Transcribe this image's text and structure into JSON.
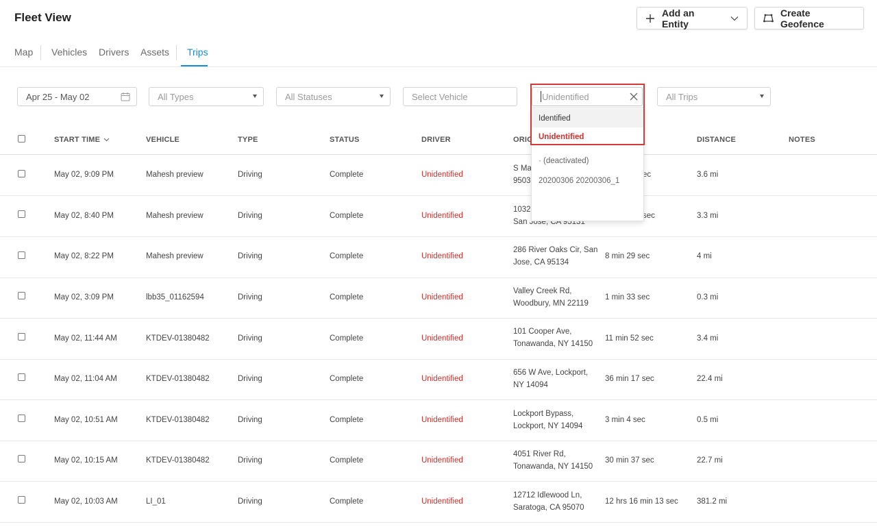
{
  "title": "Fleet View",
  "header_buttons": {
    "add_entity": "Add an Entity",
    "create_geofence": "Create Geofence"
  },
  "tabs": [
    "Map",
    "Vehicles",
    "Drivers",
    "Assets",
    "Trips"
  ],
  "active_tab": "Trips",
  "filters": {
    "date": "Apr 25 - May 02",
    "types_placeholder": "All Types",
    "statuses_placeholder": "All Statuses",
    "vehicle_placeholder": "Select Vehicle",
    "driver_placeholder": "Unidentified",
    "trips_placeholder": "All Trips"
  },
  "driver_dropdown": {
    "options": [
      "Identified",
      "Unidentified",
      "· (deactivated)",
      "20200306 20200306_1"
    ],
    "selected": "Unidentified",
    "hovered": "Identified"
  },
  "columns": [
    "START TIME",
    "VEHICLE",
    "TYPE",
    "STATUS",
    "DRIVER",
    "ORIG",
    "",
    "DISTANCE",
    "NOTES"
  ],
  "rows": [
    {
      "start": "May 02, 9:09 PM",
      "vehicle": "Mahesh preview",
      "type": "Driving",
      "status": "Complete",
      "driver": "Unidentified",
      "origin1": "S Ma",
      "origin2": "9503",
      "duration": "ec",
      "distance": "3.6 mi"
    },
    {
      "start": "May 02, 8:40 PM",
      "vehicle": "Mahesh preview",
      "type": "Driving",
      "status": "Complete",
      "driver": "Unidentified",
      "origin1": "1032",
      "origin2": "San Jose, CA 95131",
      "duration": "sec",
      "distance": "3.3 mi"
    },
    {
      "start": "May 02, 8:22 PM",
      "vehicle": "Mahesh preview",
      "type": "Driving",
      "status": "Complete",
      "driver": "Unidentified",
      "origin1": "286 River Oaks Cir, San",
      "origin2": "Jose, CA 95134",
      "duration": "8 min 29 sec",
      "distance": "4 mi"
    },
    {
      "start": "May 02, 3:09 PM",
      "vehicle": "lbb35_01162594",
      "type": "Driving",
      "status": "Complete",
      "driver": "Unidentified",
      "origin1": "Valley Creek Rd,",
      "origin2": "Woodbury, MN 22119",
      "duration": "1 min 33 sec",
      "distance": "0.3 mi"
    },
    {
      "start": "May 02, 11:44 AM",
      "vehicle": "KTDEV-01380482",
      "type": "Driving",
      "status": "Complete",
      "driver": "Unidentified",
      "origin1": "101 Cooper Ave,",
      "origin2": "Tonawanda, NY 14150",
      "duration": "11 min 52 sec",
      "distance": "3.4 mi"
    },
    {
      "start": "May 02, 11:04 AM",
      "vehicle": "KTDEV-01380482",
      "type": "Driving",
      "status": "Complete",
      "driver": "Unidentified",
      "origin1": "656 W Ave, Lockport,",
      "origin2": "NY 14094",
      "duration": "36 min 17 sec",
      "distance": "22.4 mi"
    },
    {
      "start": "May 02, 10:51 AM",
      "vehicle": "KTDEV-01380482",
      "type": "Driving",
      "status": "Complete",
      "driver": "Unidentified",
      "origin1": "Lockport Bypass,",
      "origin2": "Lockport, NY 14094",
      "duration": "3 min 4 sec",
      "distance": "0.5 mi"
    },
    {
      "start": "May 02, 10:15 AM",
      "vehicle": "KTDEV-01380482",
      "type": "Driving",
      "status": "Complete",
      "driver": "Unidentified",
      "origin1": "4051 River Rd,",
      "origin2": "Tonawanda, NY 14150",
      "duration": "30 min 37 sec",
      "distance": "22.7 mi"
    },
    {
      "start": "May 02, 10:03 AM",
      "vehicle": "LI_01",
      "type": "Driving",
      "status": "Complete",
      "driver": "Unidentified",
      "origin1": "12712 Idlewood Ln,",
      "origin2": "Saratoga, CA 95070",
      "duration": "12 hrs 16 min 13 sec",
      "distance": "381.2 mi"
    }
  ],
  "colors": {
    "accent": "#1a8ad6",
    "alert_red": "#d0312d",
    "highlight_box": "#d23a3a"
  }
}
